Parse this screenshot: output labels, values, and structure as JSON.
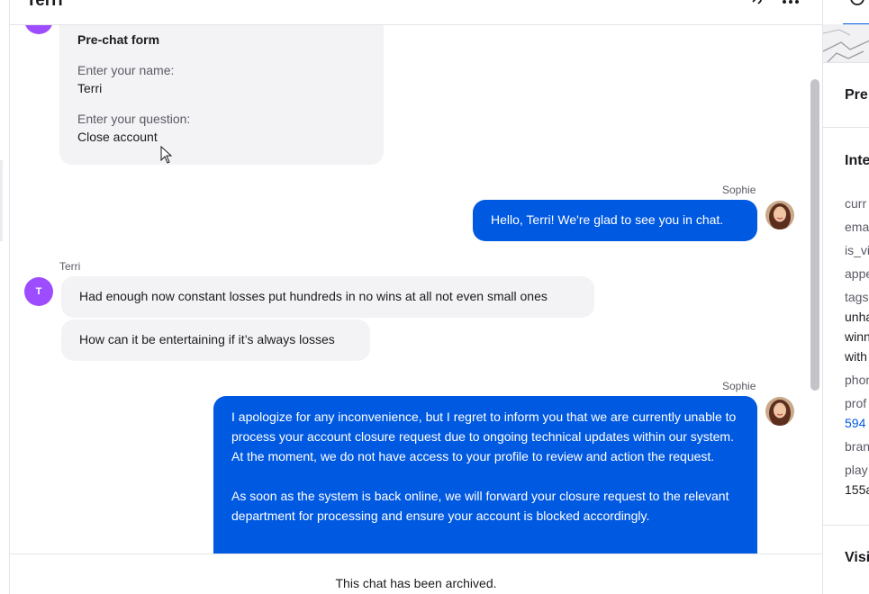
{
  "header": {
    "title": "Terri"
  },
  "prechat": {
    "title": "Pre-chat form",
    "name_label": "Enter your name:",
    "name_value": "Terri",
    "question_label": "Enter your question:",
    "question_value": "Close account"
  },
  "messages": [
    {
      "author": "Sophie",
      "text": "Hello, Terri! We're glad to see you in chat."
    },
    {
      "author": "Terri",
      "initial": "T",
      "text": "Had enough now constant losses put hundreds in no wins at all not even small ones"
    },
    {
      "text": "How can it be entertaining if it’s always losses"
    },
    {
      "author": "Sophie",
      "paragraphs": [
        "I apologize for any inconvenience, but I regret to inform you that we are currently unable to process your account closure request due to ongoing technical updates within our system. At the moment, we do not have access to your profile to review and action the request.",
        "As soon as the system is back online, we will forward your closure request to the relevant department for processing and ensure your account is blocked accordingly."
      ]
    }
  ],
  "footer": {
    "status": "This chat has been archived."
  },
  "sidebar": {
    "heading_pre": "Pre",
    "heading_inte": "Inte",
    "rows": [
      "curr",
      "ema",
      "is_vi",
      "appe",
      "tags"
    ],
    "tags_values": [
      "unha",
      "winn",
      "with"
    ],
    "phone_label": "phon",
    "prof_label": "prof",
    "prof_value": "594",
    "brand_label": "bran",
    "player_label": "play",
    "player_value": "155a",
    "heading_visi": "Visi"
  },
  "colors": {
    "accent": "#0059e1",
    "avatar_user": "#9d4dff",
    "bubble_user": "#f3f3f5"
  }
}
